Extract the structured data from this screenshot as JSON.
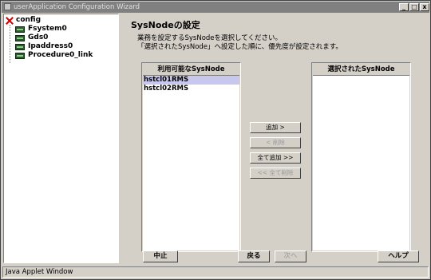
{
  "window": {
    "title": "userApplication Configuration Wizard",
    "minimize_glyph": "_",
    "maximize_glyph": "□",
    "close_glyph": "x"
  },
  "tree": {
    "root": {
      "label": "config",
      "icon": "config-root-icon"
    },
    "children": [
      {
        "label": "Fsystem0",
        "icon": "resource-icon"
      },
      {
        "label": "Gds0",
        "icon": "resource-icon"
      },
      {
        "label": "Ipaddress0",
        "icon": "resource-icon"
      },
      {
        "label": "Procedure0_link",
        "icon": "resource-icon"
      }
    ]
  },
  "page": {
    "title": "SysNodeの設定",
    "description_line1": "業務を設定するSysNodeを選択してください。",
    "description_line2": "「選択されたSysNode」へ設定した順に、優先度が設定されます。"
  },
  "available_list": {
    "header": "利用可能なSysNode",
    "items": [
      "hstcl01RMS",
      "hstcl02RMS"
    ],
    "selected_index": 0
  },
  "selected_list": {
    "header": "選択されたSysNode",
    "items": []
  },
  "transfer_buttons": {
    "add": "追加 >",
    "remove": "< 削除",
    "add_all": "全て追加 >>",
    "remove_all": "<< 全て削除"
  },
  "footer_buttons": {
    "cancel": "中止",
    "back": "戻る",
    "next": "次へ",
    "help": "ヘルプ"
  },
  "status_bar": {
    "text": "Java Applet Window"
  },
  "colors": {
    "window_bg": "#d4d0c8",
    "titlebar_bg": "#808080",
    "selection_bg": "#c8c8ee",
    "root_icon": "#d00000",
    "resource_icon": "#2c5a2c"
  }
}
